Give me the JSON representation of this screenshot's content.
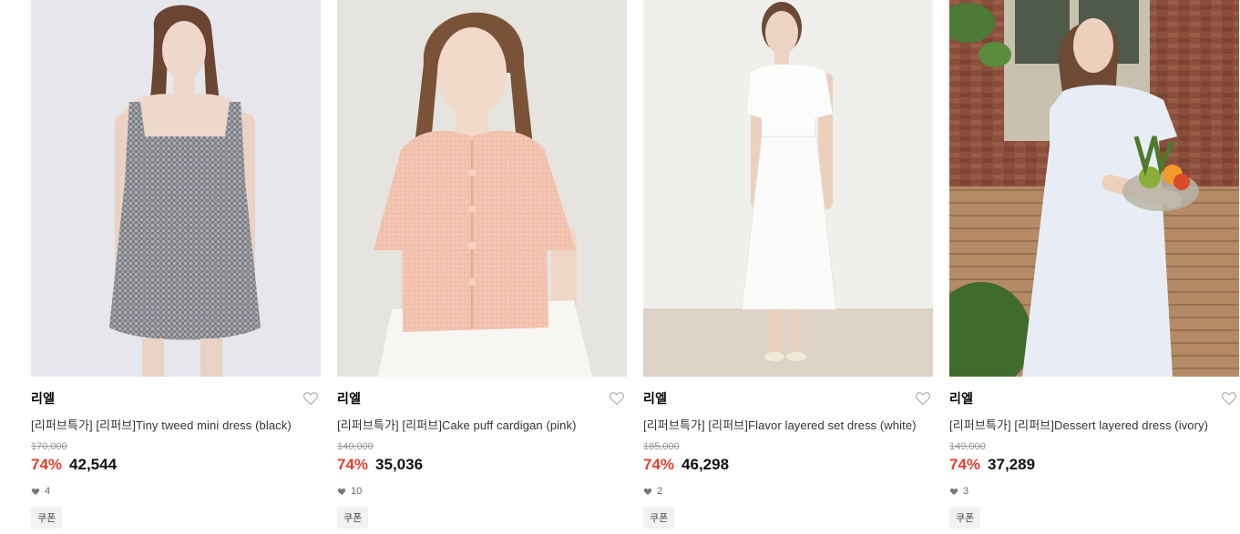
{
  "products": [
    {
      "brand": "리엘",
      "title": "[리퍼브특가] [리퍼브]Tiny tweed mini dress (black)",
      "original_price": "170,000",
      "discount": "74%",
      "price": "42,544",
      "likes": "4",
      "badge": "쿠폰",
      "colors": {
        "bg": "#e7e9ee",
        "garment": "#8d8f95",
        "skin": "#edd6c8",
        "hair": "#6b4531"
      }
    },
    {
      "brand": "리엘",
      "title": "[리퍼브특가] [리퍼브]Cake puff cardigan (pink)",
      "original_price": "140,000",
      "discount": "74%",
      "price": "35,036",
      "likes": "10",
      "badge": "쿠폰",
      "colors": {
        "bg": "#e4e2dd",
        "garment": "#f2bfab",
        "skin": "#f1d9ca",
        "hair": "#7a5238"
      }
    },
    {
      "brand": "리엘",
      "title": "[리퍼브특가] [리퍼브]Flavor layered set dress (white)",
      "original_price": "185,000",
      "discount": "74%",
      "price": "46,298",
      "likes": "2",
      "badge": "쿠폰",
      "colors": {
        "bg": "#eeefec",
        "garment": "#fbfbf9",
        "skin": "#ecd3c0",
        "hair": "#6a4a36",
        "floor": "#ddd3c6"
      }
    },
    {
      "brand": "리엘",
      "title": "[리퍼브특가] [리퍼브]Dessert layered dress (ivory)",
      "original_price": "149,000",
      "discount": "74%",
      "price": "37,289",
      "likes": "3",
      "badge": "쿠폰",
      "colors": {
        "bg": "#b98b6b",
        "garment": "#e9eef5",
        "skin": "#ecd0bc",
        "hair": "#6e4a35",
        "brick": "#8a4f3c",
        "leaf": "#4d7a35"
      }
    }
  ],
  "theme": {
    "discount_color": "#e83d2f",
    "strike_color": "#999999"
  }
}
